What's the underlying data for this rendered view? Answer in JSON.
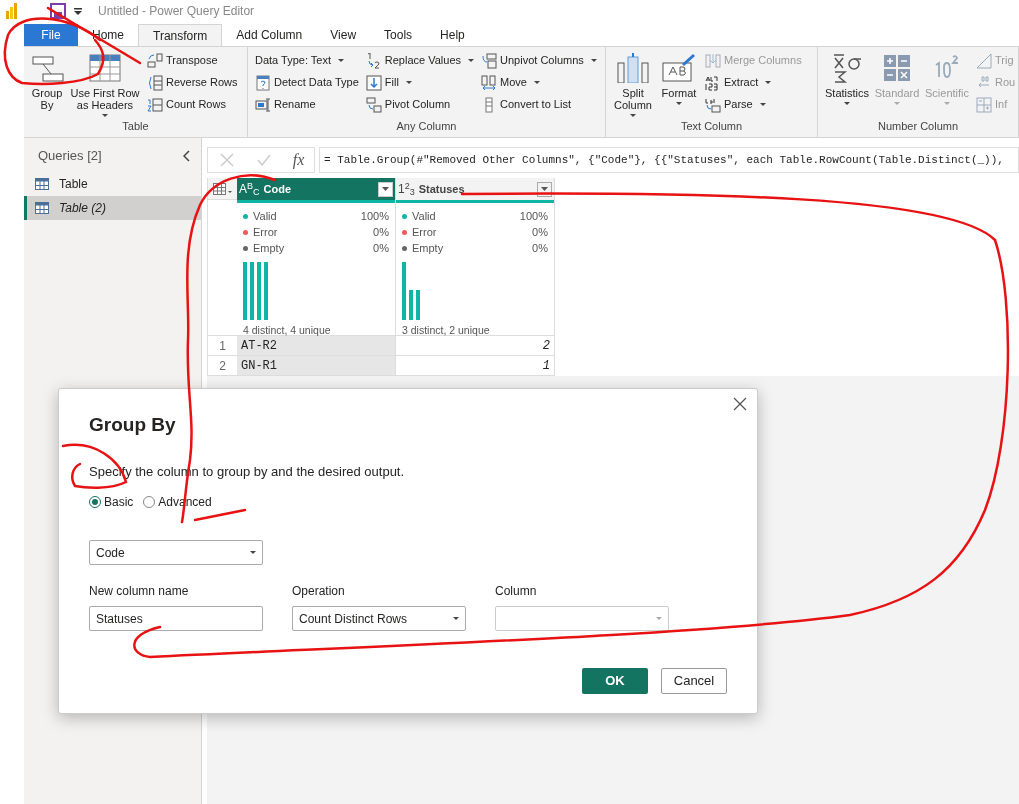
{
  "title_bar": {
    "title": "Untitled - Power Query Editor"
  },
  "ribbon_tabs": [
    {
      "label": "File",
      "kind": "file",
      "selected": false
    },
    {
      "label": "Home",
      "kind": "tab",
      "selected": false
    },
    {
      "label": "Transform",
      "kind": "tab",
      "selected": true
    },
    {
      "label": "Add Column",
      "kind": "tab",
      "selected": false
    },
    {
      "label": "View",
      "kind": "tab",
      "selected": false
    },
    {
      "label": "Tools",
      "kind": "tab",
      "selected": false
    },
    {
      "label": "Help",
      "kind": "tab",
      "selected": false
    }
  ],
  "ribbon_groups": [
    {
      "label": "Table",
      "items": [
        {
          "kind": "large",
          "label": "Group By"
        },
        {
          "kind": "large",
          "label": "Use First Row as Headers",
          "dropdown": true
        },
        {
          "kind": "stack",
          "items": [
            {
              "label": "Transpose"
            },
            {
              "label": "Reverse Rows"
            },
            {
              "label": "Count Rows"
            }
          ]
        }
      ]
    },
    {
      "label": "Any Column",
      "items": [
        {
          "kind": "stack",
          "items": [
            {
              "label": "Data Type: Text",
              "dropdown": true
            },
            {
              "label": "Detect Data Type"
            },
            {
              "label": "Rename"
            }
          ]
        },
        {
          "kind": "stack",
          "items": [
            {
              "label": "Replace Values",
              "dropdown": true
            },
            {
              "label": "Fill",
              "dropdown": true
            },
            {
              "label": "Pivot Column"
            }
          ]
        },
        {
          "kind": "stack",
          "items": [
            {
              "label": "Unpivot Columns",
              "dropdown": true
            },
            {
              "label": "Move",
              "dropdown": true
            },
            {
              "label": "Convert to List"
            }
          ]
        }
      ]
    },
    {
      "label": "Text Column",
      "items": [
        {
          "kind": "large",
          "label": "Split Column",
          "dropdown": true
        },
        {
          "kind": "large",
          "label": "Format",
          "dropdown": true
        },
        {
          "kind": "stack",
          "items": [
            {
              "label": "Merge Columns",
              "disabled": true
            },
            {
              "label": "Extract",
              "dropdown": true
            },
            {
              "label": "Parse",
              "dropdown": true
            }
          ]
        }
      ]
    },
    {
      "label": "Number Column",
      "items": [
        {
          "kind": "large",
          "label": "Statistics",
          "dropdown": true
        },
        {
          "kind": "large",
          "label": "Standard",
          "dropdown": true,
          "disabled": true
        },
        {
          "kind": "large",
          "label": "Scientific",
          "dropdown": true,
          "disabled": true
        },
        {
          "kind": "stack",
          "items": [
            {
              "label": "Trig",
              "disabled": true
            },
            {
              "label": "Rou",
              "disabled": true
            },
            {
              "label": "Inf",
              "disabled": true
            }
          ]
        }
      ]
    }
  ],
  "queries_pane": {
    "title": "Queries [2]",
    "items": [
      {
        "label": "Table",
        "selected": false
      },
      {
        "label": "Table (2)",
        "selected": true
      }
    ]
  },
  "formula_bar": {
    "fx": "fx",
    "formula": "= Table.Group(#\"Removed Other Columns\", {\"Code\"}, {{\"Statuses\", each Table.RowCount(Table.Distinct(_)),"
  },
  "table": {
    "columns": [
      {
        "name": "Code",
        "type_icon": "A$^{B}$$_{C}$",
        "selected": true,
        "quality": [
          {
            "label": "Valid",
            "value": "100%",
            "color": "#0fb5a5"
          },
          {
            "label": "Error",
            "value": "0%",
            "color": "#f05a5a"
          },
          {
            "label": "Empty",
            "value": "0%",
            "color": "#666666"
          }
        ],
        "summary": "4 distinct, 4 unique"
      },
      {
        "name": "Statuses",
        "type_icon": "1$^{2}$$_{3}$",
        "selected": false,
        "quality": [
          {
            "label": "Valid",
            "value": "100%",
            "color": "#0fb5a5"
          },
          {
            "label": "Error",
            "value": "0%",
            "color": "#f05a5a"
          },
          {
            "label": "Empty",
            "value": "0%",
            "color": "#666666"
          }
        ],
        "summary": "3 distinct, 2 unique"
      }
    ],
    "rows": [
      {
        "number": "1",
        "cells": [
          "AT-R2",
          "2"
        ]
      },
      {
        "number": "2",
        "cells": [
          "GN-R1",
          "1"
        ]
      }
    ]
  },
  "dialog": {
    "title": "Group By",
    "description": "Specify the column to group by and the desired output.",
    "modes": [
      {
        "label": "Basic",
        "selected": true
      },
      {
        "label": "Advanced",
        "selected": false
      }
    ],
    "group_column": {
      "value": "Code"
    },
    "fields": [
      {
        "label": "New column name",
        "kind": "input",
        "value": "Statuses"
      },
      {
        "label": "Operation",
        "kind": "select",
        "value": "Count Distinct Rows"
      },
      {
        "label": "Column",
        "kind": "select",
        "disabled": true
      }
    ],
    "buttons": [
      {
        "label": "OK",
        "kind": "primary"
      },
      {
        "label": "Cancel",
        "kind": "secondary"
      }
    ]
  }
}
